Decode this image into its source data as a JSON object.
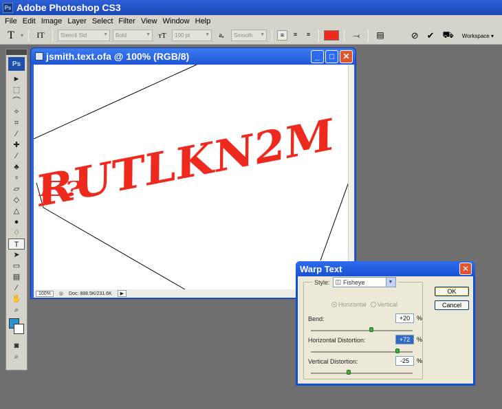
{
  "app": {
    "title": "Adobe Photoshop CS3",
    "badge": "Ps"
  },
  "menu": [
    "File",
    "Edit",
    "Image",
    "Layer",
    "Select",
    "Filter",
    "View",
    "Window",
    "Help"
  ],
  "options": {
    "tool_glyph": "T",
    "orientation_glyph": "ΙT",
    "font_family": "Stencil Std",
    "font_style": "Bold",
    "size_glyph": "тT",
    "font_size": "100 pt",
    "aa_glyph": "aₐ",
    "antialias": "Smooth",
    "text_color": "#ee2a1e",
    "workspace": "Workspace ▾"
  },
  "toolbox": {
    "logo": "Ps",
    "tools": [
      "move-tool",
      "marquee-tool",
      "lasso-tool",
      "magic-wand-tool",
      "crop-tool",
      "slice-tool",
      "healing-brush-tool",
      "brush-tool",
      "clone-stamp-tool",
      "history-brush-tool",
      "eraser-tool",
      "paint-bucket-tool",
      "blur-tool",
      "dodge-tool",
      "pen-tool",
      "type-tool",
      "path-selection-tool",
      "rectangle-tool",
      "notes-tool",
      "eyedropper-tool",
      "hand-tool",
      "zoom-tool"
    ],
    "tool_glyphs": [
      "►",
      "⬚",
      "⌒",
      "✧",
      "⌗",
      "∕",
      "✚",
      "∕",
      "♣",
      "♀",
      "▱",
      "◇",
      "△",
      "●",
      "♢",
      "T",
      "➤",
      "▭",
      "▤",
      "⁄",
      "✋",
      "⌕"
    ],
    "foreground_color": "#2b93d0",
    "background_color": "#ffffff"
  },
  "document": {
    "title": "jsmith.text.ofa @ 100% (RGB/8)",
    "line1": "RUTLKN2M",
    "line2": "E?",
    "text_color": "#ee2a1e",
    "zoom": "100%",
    "doc_info": "Doc: 888.5K/231.6K"
  },
  "dialog": {
    "title": "Warp Text",
    "style_label": "Style:",
    "style_value": "Fisheye",
    "horizontal": "Horizontal",
    "vertical": "Vertical",
    "bend_label": "Bend:",
    "bend_value": "+20",
    "bend_level": 0.6,
    "hdist_label": "Horizontal Distortion:",
    "hdist_value": "+72",
    "hdist_level": 0.86,
    "vdist_label": "Vertical Distortion:",
    "vdist_value": "-25",
    "vdist_level": 0.375,
    "pct": "%",
    "ok": "OK",
    "cancel": "Cancel"
  }
}
